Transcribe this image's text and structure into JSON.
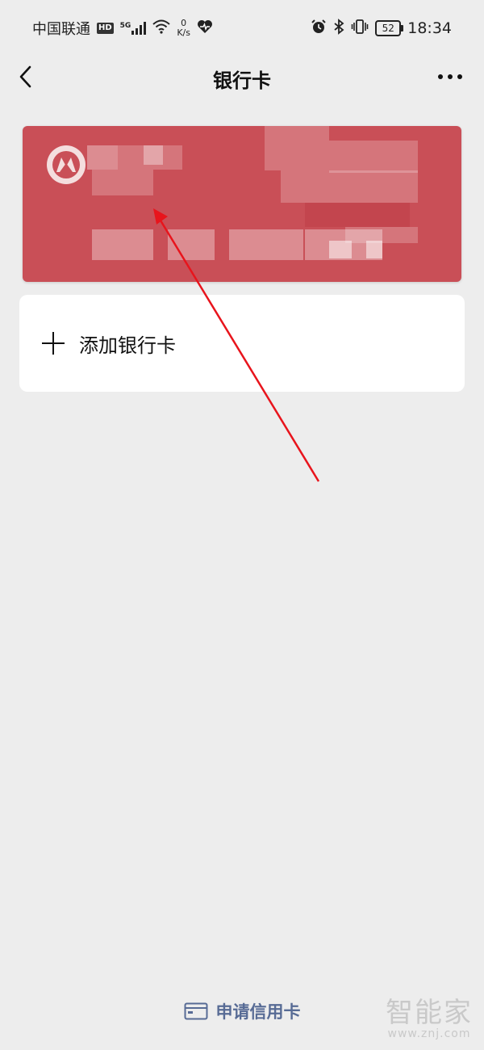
{
  "status_bar": {
    "carrier": "中国联通",
    "hd": "HD",
    "network": "5G",
    "speed_value": "0",
    "speed_unit": "K/s",
    "battery": "52",
    "time": "18:34",
    "icons": [
      "hd-icon",
      "signal-icon",
      "wifi-icon",
      "heart-rate-icon",
      "alarm-icon",
      "bluetooth-icon",
      "vibrate-icon",
      "battery-icon"
    ]
  },
  "nav": {
    "title": "银行卡",
    "back_icon": "chevron-left-icon",
    "more_icon": "more-dots-icon"
  },
  "bank_card": {
    "brand_color": "#c94f57",
    "logo_icon": "bank-logo-icon"
  },
  "add_card": {
    "label": "添加银行卡",
    "icon": "plus-icon"
  },
  "apply": {
    "label": "申请信用卡",
    "icon": "credit-card-icon",
    "color": "#576b95"
  },
  "watermark": {
    "title": "智能家",
    "url": "www.znj.com"
  },
  "annotation": {
    "color": "#e8141c"
  }
}
